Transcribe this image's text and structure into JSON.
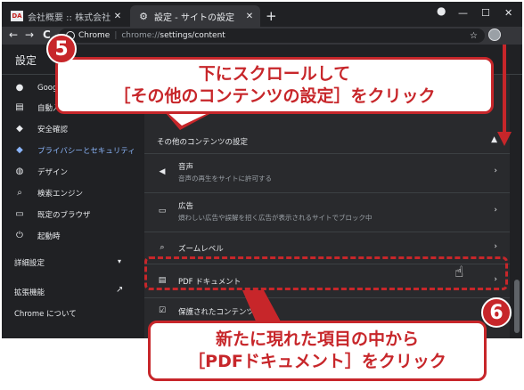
{
  "browser": {
    "tabs": [
      {
        "title": "会社概要 :: 株式会社デジタルアドバ",
        "favicon_text": "DA",
        "active": false
      },
      {
        "title": "設定 - サイトの設定",
        "favicon_text": "⚙",
        "active": true
      }
    ],
    "tab_close_glyph": "✕",
    "new_tab_glyph": "+",
    "window_controls": {
      "minimize": "—",
      "maximize": "☐",
      "close": "✕"
    },
    "toolbar": {
      "back": "←",
      "forward": "→",
      "reload": "C"
    },
    "omnibox": {
      "brand": "Chrome",
      "separator": "|",
      "url_scheme": "chrome://",
      "url_path": "settings/content",
      "star": "☆"
    }
  },
  "settings": {
    "page_title": "設定",
    "sidebar": [
      {
        "label": "Google",
        "icon": "person-icon",
        "glyph": "●"
      },
      {
        "label": "自動入力",
        "icon": "clipboard-icon",
        "glyph": "▤"
      },
      {
        "label": "安全確認",
        "icon": "shield-icon",
        "glyph": "◆"
      },
      {
        "label": "プライバシーとセキュリティ",
        "icon": "shield-lock-icon",
        "glyph": "◆",
        "selected": true
      },
      {
        "label": "デザイン",
        "icon": "palette-icon",
        "glyph": "◍"
      },
      {
        "label": "検索エンジン",
        "icon": "search-icon",
        "glyph": "⌕"
      },
      {
        "label": "既定のブラウザ",
        "icon": "browser-icon",
        "glyph": "▭"
      },
      {
        "label": "起動時",
        "icon": "power-icon",
        "glyph": "⏻"
      }
    ],
    "advanced_label": "詳細設定",
    "advanced_chevron": "▾",
    "extensions_label": "拡張機能",
    "external_link_glyph": "↗",
    "about_label": "Chrome について",
    "content_section": {
      "group_title": "その他のコンテンツの設定",
      "collapse_glyph": "▲",
      "arrow_glyph": "›",
      "rows": [
        {
          "icon": "speaker-icon",
          "glyph": "◀",
          "title": "音声",
          "subtitle": "音声の再生をサイトに許可する"
        },
        {
          "icon": "ad-icon",
          "glyph": "▭",
          "title": "広告",
          "subtitle": "煩わしい広告や誤解を招く広告が表示されるサイトでブロック中"
        },
        {
          "icon": "zoom-icon",
          "glyph": "⌕",
          "title": "ズームレベル",
          "subtitle": ""
        },
        {
          "icon": "pdf-icon",
          "glyph": "▤",
          "title": "PDF ドキュメント",
          "subtitle": ""
        },
        {
          "icon": "protected-content-icon",
          "glyph": "☑",
          "title": "保護されたコンテンツ",
          "subtitle": ""
        }
      ]
    },
    "pointer_glyph": "☝"
  },
  "annotations": {
    "step5": {
      "number": "5",
      "lines": [
        "下にスクロールして",
        "［その他のコンテンツの設定］をクリック"
      ]
    },
    "step6": {
      "number": "6",
      "lines": [
        "新たに現れた項目の中から",
        "［PDFドキュメント］をクリック"
      ]
    },
    "accent_color": "#c7262a"
  }
}
